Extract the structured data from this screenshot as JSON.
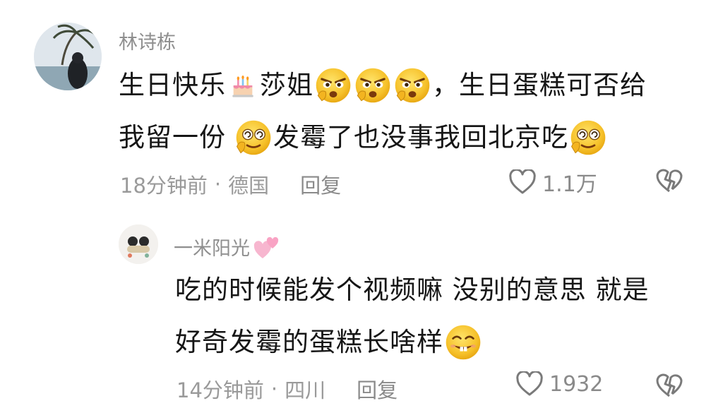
{
  "comments": [
    {
      "username": "林诗栋",
      "text_line1": "生日快乐",
      "text_line1_b": "莎姐",
      "text_line1_c": "，生日蛋糕可否给",
      "text_line2": "我留一份",
      "text_line2_b": "发霉了也没事我回北京吃",
      "time": "18分钟前",
      "separator": "·",
      "location": "德国",
      "reply_label": "回复",
      "likes": "1.1万"
    },
    {
      "username": "一米阳光",
      "text_line1": "吃的时候能发个视频嘛 没别的意思 就是",
      "text_line2": "好奇发霉的蛋糕长啥样",
      "time": "14分钟前",
      "separator": "·",
      "location": "四川",
      "reply_label": "回复",
      "likes": "1932"
    }
  ],
  "icons": {
    "cake": "birthday-cake-icon",
    "angry": "angry-face-icon",
    "dizzy": "dizzy-face-icon",
    "grin": "buck-tooth-grin-icon",
    "heart": "heart-outline-icon",
    "broken_heart": "broken-heart-icon",
    "pink_hearts": "pink-hearts-icon"
  },
  "colors": {
    "meta_gray": "#9a9a9a",
    "emoji_yellow": "#f7c531"
  }
}
